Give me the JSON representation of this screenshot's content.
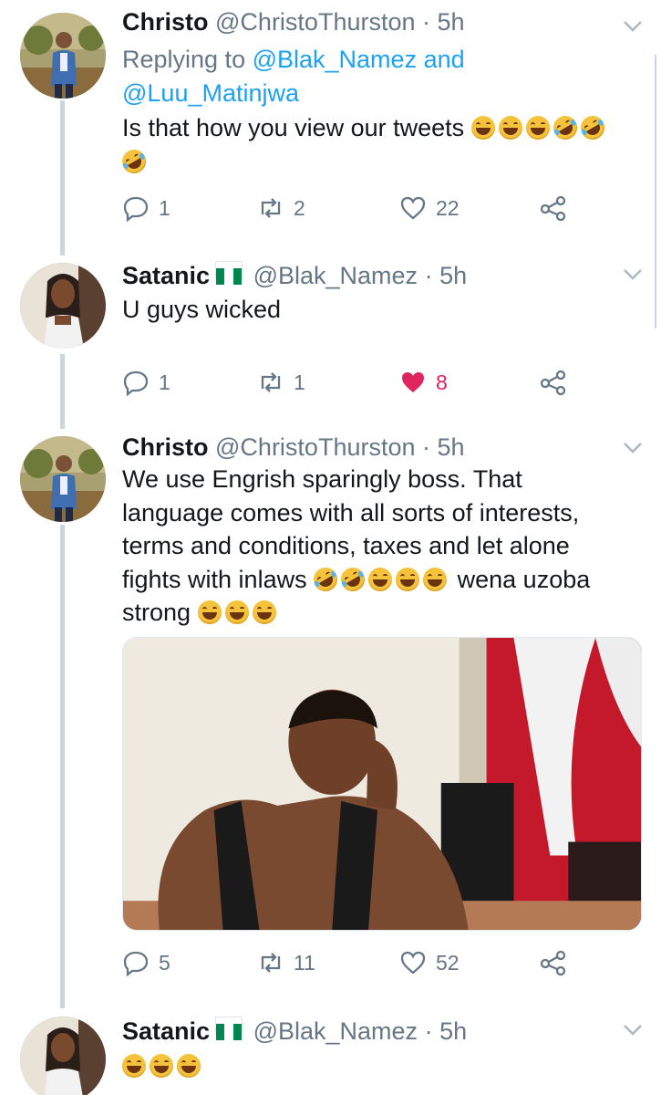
{
  "tweets": [
    {
      "name": "Christo",
      "handle": "@ChristoThurston",
      "dot": "·",
      "time": "5h",
      "replying_prefix": "Replying to ",
      "replying_mention_1": "@Blak_Namez",
      "replying_and": " and",
      "replying_mention_2": "@Luu_Matinjwa",
      "text": "Is that how you view our tweets",
      "emojis": [
        "grinning-sweat-emoji",
        "grinning-sweat-emoji",
        "grinning-sweat-emoji",
        "rofl-emoji",
        "rofl-emoji",
        "rofl-emoji"
      ],
      "replies": "1",
      "retweets": "2",
      "likes": "22",
      "liked": false
    },
    {
      "name": "Satanic",
      "flag": "nigeria-flag",
      "handle": "@Blak_Namez",
      "dot": "·",
      "time": "5h",
      "text": "U guys wicked",
      "replies": "1",
      "retweets": "1",
      "likes": "8",
      "liked": true
    },
    {
      "name": "Christo",
      "handle": "@ChristoThurston",
      "dot": "·",
      "time": "5h",
      "text_line_1": "We use Engrish sparingly boss. That",
      "text_line_2": "language comes with all sorts of interests,",
      "text_line_3": "terms and conditions, taxes and let alone",
      "text_line_4a": "fights with inlaws",
      "text_line_4b": "wena uzoba",
      "text_line_5": "strong",
      "replies": "5",
      "retweets": "11",
      "likes": "52",
      "liked": false
    },
    {
      "name": "Satanic",
      "flag": "nigeria-flag",
      "handle": "@Blak_Namez",
      "dot": "·",
      "time": "5h"
    }
  ],
  "colors": {
    "accent": "#1da1f2",
    "like": "#e0245e",
    "secondary": "#657786",
    "thread": "#ccd6dd"
  }
}
